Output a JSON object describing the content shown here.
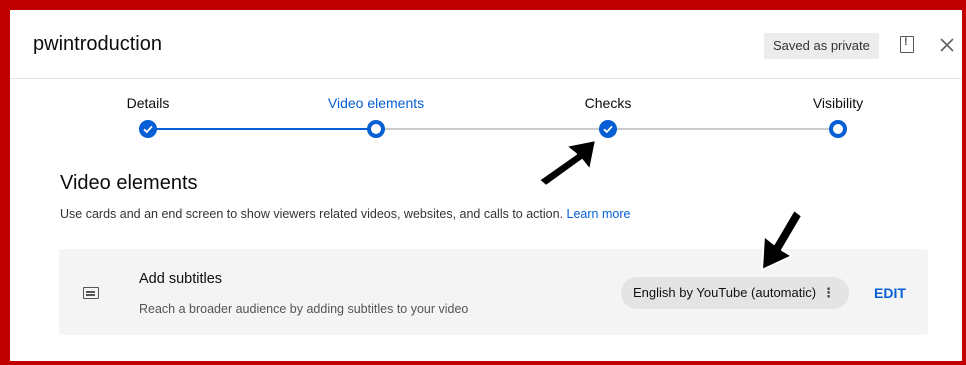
{
  "header": {
    "title": "pwintroduction",
    "status_badge": "Saved as private",
    "feedback_icon": "feedback-icon",
    "close_icon": "close-icon"
  },
  "stepper": {
    "steps": [
      {
        "label": "Details",
        "state": "done"
      },
      {
        "label": "Video elements",
        "state": "current"
      },
      {
        "label": "Checks",
        "state": "done"
      },
      {
        "label": "Visibility",
        "state": "pending"
      }
    ],
    "accent_color": "#065fd4"
  },
  "section": {
    "title": "Video elements",
    "description": "Use cards and an end screen to show viewers related videos, websites, and calls to action.",
    "learn_more": "Learn more"
  },
  "card": {
    "icon": "subtitles-icon",
    "title": "Add subtitles",
    "subtitle": "Reach a broader audience by adding subtitles to your video",
    "chip_label": "English by YouTube (automatic)",
    "chip_menu": "⋮",
    "edit_label": "EDIT"
  },
  "annotations": {
    "arrow_color": "#000000",
    "frame_color": "#c00000"
  }
}
